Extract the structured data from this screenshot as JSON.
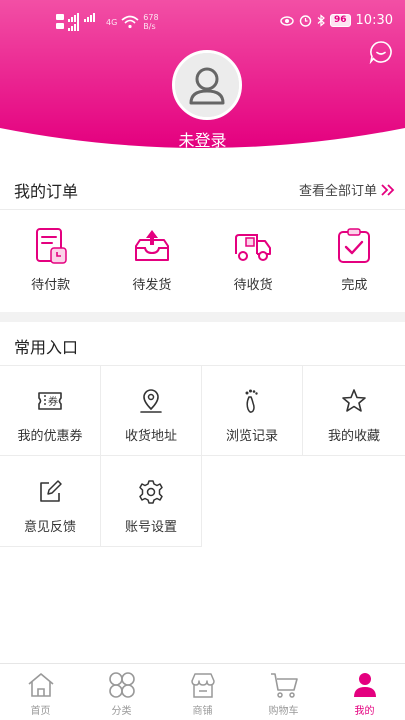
{
  "colors": {
    "accent": "#e4007f",
    "gradient_start": "#f24fa5",
    "gradient_end": "#e4007f",
    "text": "#333333",
    "muted": "#999999"
  },
  "status_bar": {
    "network_speed_value": "678",
    "network_speed_unit": "B/s",
    "network_type": "4G",
    "battery": "96",
    "time": "10:30"
  },
  "profile": {
    "login_text": "未登录",
    "avatar_icon": "user-avatar-icon",
    "message_icon": "chat-bubble-icon"
  },
  "orders": {
    "title": "我的订单",
    "view_all": "查看全部订单",
    "items": [
      {
        "label": "待付款",
        "icon": "pending-payment-icon"
      },
      {
        "label": "待发货",
        "icon": "pending-shipment-icon"
      },
      {
        "label": "待收货",
        "icon": "pending-receipt-icon"
      },
      {
        "label": "完成",
        "icon": "completed-icon"
      }
    ]
  },
  "shortcuts": {
    "title": "常用入口",
    "items": [
      {
        "label": "我的优惠券",
        "icon": "coupon-icon"
      },
      {
        "label": "收货地址",
        "icon": "location-icon"
      },
      {
        "label": "浏览记录",
        "icon": "footprint-icon"
      },
      {
        "label": "我的收藏",
        "icon": "star-icon"
      },
      {
        "label": "意见反馈",
        "icon": "edit-icon"
      },
      {
        "label": "账号设置",
        "icon": "gear-icon"
      }
    ]
  },
  "tabbar": {
    "items": [
      {
        "label": "首页",
        "icon": "home-icon",
        "active": false
      },
      {
        "label": "分类",
        "icon": "category-icon",
        "active": false
      },
      {
        "label": "商铺",
        "icon": "shop-icon",
        "active": false
      },
      {
        "label": "购物车",
        "icon": "cart-icon",
        "active": false
      },
      {
        "label": "我的",
        "icon": "profile-icon",
        "active": true
      }
    ]
  }
}
